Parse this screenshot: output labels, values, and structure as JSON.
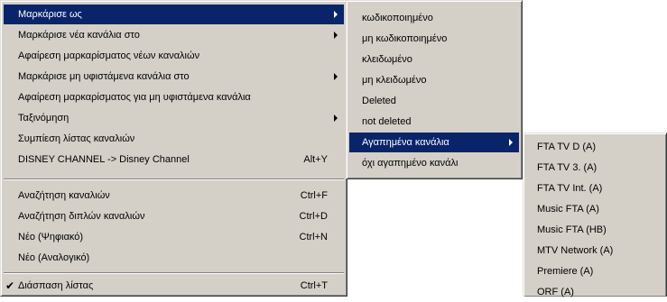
{
  "main_menu": {
    "items": [
      {
        "label": "Μαρκάρισε ως",
        "shortcut": ""
      },
      {
        "label": "Μαρκάρισε νέα κανάλια στο",
        "shortcut": ""
      },
      {
        "label": "Αφαίρεση μαρκαρίσματος νέων καναλιών",
        "shortcut": ""
      },
      {
        "label": "Μαρκάρισε μη υφιστάμενα κανάλια στο",
        "shortcut": ""
      },
      {
        "label": "Αφαίρεση μαρκαρίσματος για μη υφιστάμενα κανάλια",
        "shortcut": ""
      },
      {
        "label": "Ταξινόμηση",
        "shortcut": ""
      },
      {
        "label": "Συμπίεση λίστας καναλιών",
        "shortcut": ""
      },
      {
        "label": "DISNEY CHANNEL -> Disney Channel",
        "shortcut": "Alt+Y"
      },
      {
        "label": "Αναζήτηση καναλιών",
        "shortcut": "Ctrl+F"
      },
      {
        "label": "Αναζήτηση διπλών καναλιών",
        "shortcut": "Ctrl+D"
      },
      {
        "label": "Νέο (Ψηφιακό)",
        "shortcut": "Ctrl+N"
      },
      {
        "label": "Νέο (Αναλογικό)",
        "shortcut": ""
      },
      {
        "label": "Διάσπαση λίστας",
        "shortcut": "Ctrl+T",
        "checked": true
      }
    ]
  },
  "mark_as_submenu": {
    "items": [
      {
        "label": "κωδικοποιημένο"
      },
      {
        "label": "μη κωδικοποιημένο"
      },
      {
        "label": "κλειδωμένο"
      },
      {
        "label": "μη κλειδωμένο"
      },
      {
        "label": "Deleted"
      },
      {
        "label": "not deleted"
      },
      {
        "label": "Αγαπημένα κανάλια"
      },
      {
        "label": "όχι αγαπημένο κανάλι"
      }
    ]
  },
  "favorites_submenu": {
    "items": [
      {
        "label": "FTA TV D (A)"
      },
      {
        "label": "FTA TV 3. (A)"
      },
      {
        "label": "FTA TV Int. (A)"
      },
      {
        "label": "Music FTA (A)"
      },
      {
        "label": "Music FTA (HB)"
      },
      {
        "label": "MTV Network (A)"
      },
      {
        "label": "Premiere (A)"
      },
      {
        "label": "ORF (A)"
      }
    ]
  },
  "colors": {
    "menu_bg": "#d4d0c8",
    "highlight": "#0a246a",
    "highlight_text": "#ffffff"
  },
  "icons": {
    "submenu": "triangle-right-arrow",
    "check": "checkmark"
  }
}
